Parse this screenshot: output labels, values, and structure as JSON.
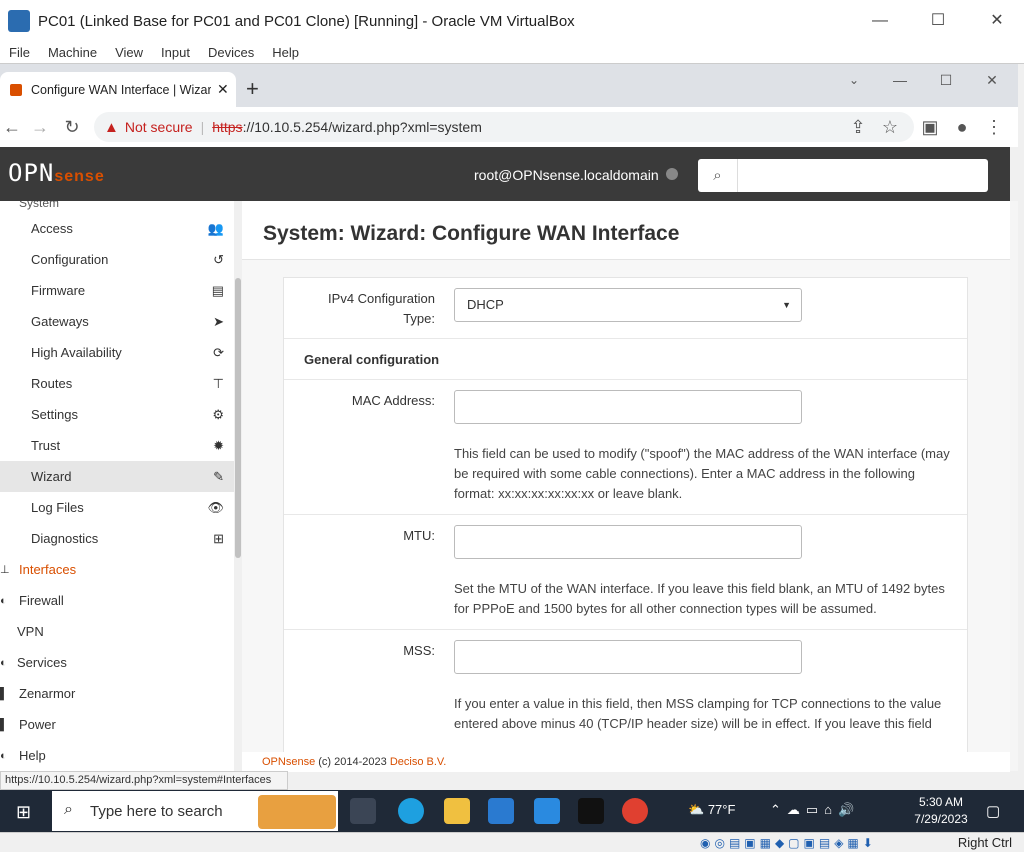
{
  "vbox": {
    "title": "PC01 (Linked Base for PC01 and PC01 Clone) [Running] - Oracle VM VirtualBox",
    "menu": [
      "File",
      "Machine",
      "View",
      "Input",
      "Devices",
      "Help"
    ],
    "host_key": "Right Ctrl"
  },
  "browser": {
    "tab_title": "Configure WAN Interface | Wizard",
    "not_secure": "Not secure",
    "url_scheme": "https",
    "url_rest": "://10.10.5.254/wizard.php?xml=system",
    "status_url": "https://10.10.5.254/wizard.php?xml=system#Interfaces"
  },
  "opnsense": {
    "logo_main": "OPN",
    "logo_sense": "sense",
    "user": "root@OPNsense.localdomain",
    "search_placeholder": ""
  },
  "sidebar": {
    "system_items": [
      {
        "label": "Access",
        "icon": "users-icon"
      },
      {
        "label": "Configuration",
        "icon": "history-icon"
      },
      {
        "label": "Firmware",
        "icon": "server-icon"
      },
      {
        "label": "Gateways",
        "icon": "location-arrow-icon"
      },
      {
        "label": "High Availability",
        "icon": "refresh-icon"
      },
      {
        "label": "Routes",
        "icon": "map-signs-icon"
      },
      {
        "label": "Settings",
        "icon": "cogs-icon"
      },
      {
        "label": "Trust",
        "icon": "certificate-icon"
      },
      {
        "label": "Wizard",
        "icon": "magic-icon"
      },
      {
        "label": "Log Files",
        "icon": "eye-icon"
      },
      {
        "label": "Diagnostics",
        "icon": "medkit-icon"
      }
    ],
    "top_items": [
      {
        "label": "Interfaces"
      },
      {
        "label": "Firewall"
      },
      {
        "label": "VPN"
      },
      {
        "label": "Services"
      },
      {
        "label": "Zenarmor"
      },
      {
        "label": "Power"
      },
      {
        "label": "Help"
      }
    ]
  },
  "page": {
    "title": "System: Wizard: Configure WAN Interface",
    "ipv4_label": "IPv4 Configuration Type:",
    "ipv4_value": "DHCP",
    "general_heading": "General configuration",
    "mac_label": "MAC Address:",
    "mac_help": "This field can be used to modify (\"spoof\") the MAC address of the WAN interface (may be required with some cable connections). Enter a MAC address in the following format: xx:xx:xx:xx:xx:xx or leave blank.",
    "mtu_label": "MTU:",
    "mtu_help": "Set the MTU of the WAN interface. If you leave this field blank, an MTU of 1492 bytes for PPPoE and 1500 bytes for all other connection types will be assumed.",
    "mss_label": "MSS:",
    "mss_help": "If you enter a value in this field, then MSS clamping for TCP connections to the value entered above minus 40 (TCP/IP header size) will be in effect. If you leave this field"
  },
  "footer": {
    "brand": "OPNsense",
    "copy": "(c) 2014-2023",
    "company": "Deciso B.V."
  },
  "taskbar": {
    "search_placeholder": "Type here to search",
    "temperature": "77°F",
    "time": "5:30 AM",
    "date": "7/29/2023"
  }
}
